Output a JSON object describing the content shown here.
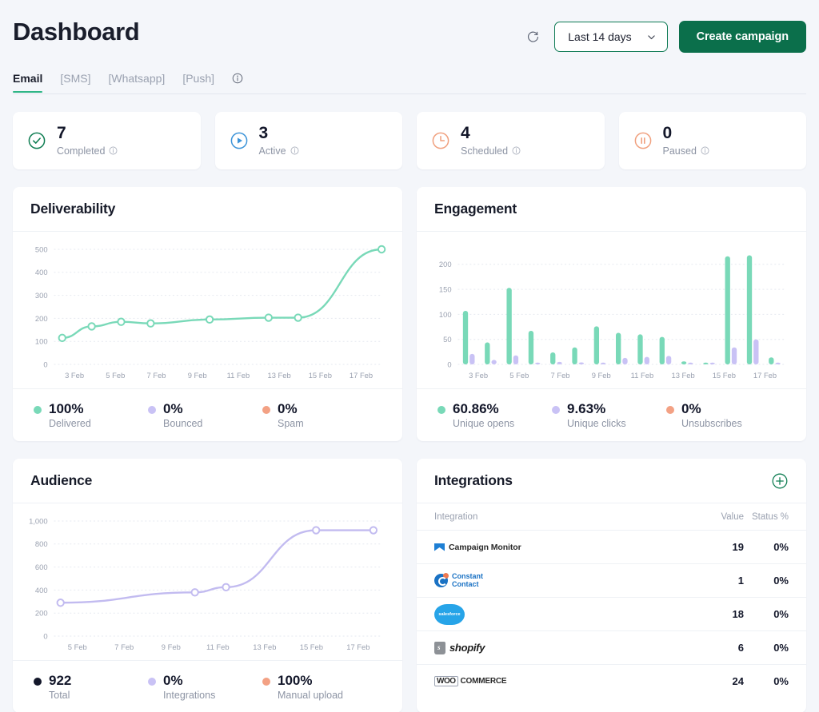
{
  "header": {
    "title": "Dashboard",
    "refresh_icon": "refresh-icon",
    "date_range": "Last 14 days",
    "chevron_icon": "chevron-down-icon",
    "create_label": "Create campaign",
    "accent_green": "#0b6f4b"
  },
  "tabs": [
    {
      "label": "Email",
      "active": true
    },
    {
      "label": "[SMS]",
      "active": false
    },
    {
      "label": "[Whatsapp]",
      "active": false
    },
    {
      "label": "[Push]",
      "active": false
    }
  ],
  "tabs_info_icon": "info-icon",
  "stats": [
    {
      "value": "7",
      "label": "Completed",
      "icon": "check-circle-icon",
      "color": "#0e7d52"
    },
    {
      "value": "3",
      "label": "Active",
      "icon": "play-circle-icon",
      "color": "#3b93d8"
    },
    {
      "value": "4",
      "label": "Scheduled",
      "icon": "clock-icon",
      "color": "#f0a07e"
    },
    {
      "value": "0",
      "label": "Paused",
      "icon": "pause-circle-icon",
      "color": "#f0a07e"
    }
  ],
  "deliverability": {
    "title": "Deliverability",
    "legend": [
      {
        "value": "100%",
        "label": "Delivered",
        "color": "#79d9b8"
      },
      {
        "value": "0%",
        "label": "Bounced",
        "color": "#c9c2f5"
      },
      {
        "value": "0%",
        "label": "Spam",
        "color": "#f3a184"
      }
    ]
  },
  "engagement": {
    "title": "Engagement",
    "legend": [
      {
        "value": "60.86%",
        "label": "Unique opens",
        "color": "#79d9b8"
      },
      {
        "value": "9.63%",
        "label": "Unique clicks",
        "color": "#c9c2f5"
      },
      {
        "value": "0%",
        "label": "Unsubscribes",
        "color": "#f3a184"
      }
    ]
  },
  "audience": {
    "title": "Audience",
    "legend": [
      {
        "value": "922",
        "label": "Total",
        "color": "#13172a"
      },
      {
        "value": "0%",
        "label": "Integrations",
        "color": "#c9c2f5"
      },
      {
        "value": "100%",
        "label": "Manual upload",
        "color": "#f3a184"
      }
    ]
  },
  "integrations": {
    "title": "Integrations",
    "add_icon": "plus-circle-icon",
    "columns": [
      "Integration",
      "Value",
      "Status %"
    ],
    "rows": [
      {
        "name": "Campaign Monitor",
        "logo": "campaign-monitor-logo",
        "value": "19",
        "status": "0%"
      },
      {
        "name": "Constant Contact",
        "logo": "constant-contact-logo",
        "value": "1",
        "status": "0%"
      },
      {
        "name": "salesforce",
        "logo": "salesforce-logo",
        "value": "18",
        "status": "0%"
      },
      {
        "name": "shopify",
        "logo": "shopify-logo",
        "value": "6",
        "status": "0%"
      },
      {
        "name": "WOOCOMMERCE",
        "logo": "woocommerce-logo",
        "value": "24",
        "status": "0%"
      }
    ]
  },
  "chart_data": [
    {
      "type": "line",
      "title": "Deliverability",
      "xlabel": "",
      "ylabel": "",
      "x": [
        "3 Feb",
        "4 Feb",
        "5 Feb",
        "6 Feb",
        "8 Feb",
        "10 Feb",
        "11 Feb",
        "15 Feb"
      ],
      "tick_labels": [
        "3 Feb",
        "5 Feb",
        "7 Feb",
        "9 Feb",
        "11 Feb",
        "13 Feb",
        "15 Feb",
        "17 Feb"
      ],
      "series": [
        {
          "name": "Delivered",
          "color": "#79d9b8",
          "values": [
            115,
            165,
            185,
            178,
            195,
            203,
            203,
            500
          ]
        }
      ],
      "ylim": [
        0,
        500
      ],
      "yticks": [
        0,
        100,
        200,
        300,
        400,
        500
      ],
      "grid": true,
      "markers": true,
      "legend_position": "bottom"
    },
    {
      "type": "bar",
      "title": "Engagement",
      "xlabel": "",
      "ylabel": "",
      "categories": [
        "3 Feb",
        "4 Feb",
        "5 Feb",
        "6 Feb",
        "7 Feb",
        "8 Feb",
        "9 Feb",
        "10 Feb",
        "11 Feb",
        "12 Feb",
        "13 Feb",
        "14 Feb",
        "15 Feb",
        "16 Feb",
        "17 Feb"
      ],
      "tick_labels": [
        "3 Feb",
        "5 Feb",
        "7 Feb",
        "9 Feb",
        "11 Feb",
        "13 Feb",
        "15 Feb",
        "17 Feb"
      ],
      "series": [
        {
          "name": "Unique opens",
          "color": "#79d9b8",
          "values": [
            107,
            44,
            153,
            67,
            24,
            34,
            76,
            63,
            60,
            55,
            6,
            2,
            216,
            218,
            14
          ]
        },
        {
          "name": "Unique clicks",
          "color": "#c9c2f5",
          "values": [
            21,
            9,
            18,
            3,
            5,
            4,
            2,
            13,
            15,
            17,
            1,
            1,
            34,
            50,
            3
          ]
        }
      ],
      "ylim": [
        0,
        230
      ],
      "yticks": [
        0,
        50,
        100,
        150,
        200
      ],
      "grid": true,
      "legend_position": "bottom"
    },
    {
      "type": "line",
      "title": "Audience",
      "xlabel": "",
      "ylabel": "",
      "x": [
        "4 Feb",
        "10 Feb",
        "11 Feb",
        "15 Feb",
        "17 Feb"
      ],
      "tick_labels": [
        "5 Feb",
        "7 Feb",
        "9 Feb",
        "11 Feb",
        "13 Feb",
        "15 Feb",
        "17 Feb"
      ],
      "series": [
        {
          "name": "Total",
          "color": "#c2bbf0",
          "values": [
            290,
            380,
            425,
            920,
            920
          ]
        }
      ],
      "ylim": [
        0,
        1000
      ],
      "yticks": [
        0,
        200,
        400,
        600,
        800,
        1000
      ],
      "ytick_labels": [
        "0",
        "200",
        "400",
        "600",
        "800",
        "1,000"
      ],
      "grid": true,
      "markers": true,
      "legend_position": "bottom"
    }
  ]
}
